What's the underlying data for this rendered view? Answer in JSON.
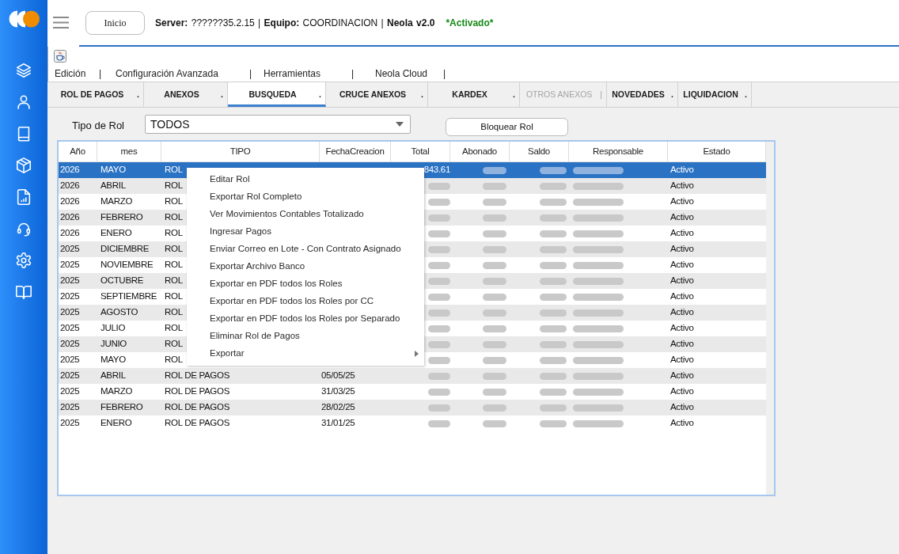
{
  "header": {
    "home_button": "Inicio",
    "status": "**Server:** ??????35.2.15 | **Equipo:** COORDINACION | **Neola v2.0**",
    "activation": "*Activado*"
  },
  "menu_bar": [
    {
      "label": "Edición",
      "separator": "|"
    },
    {
      "label": "Configuración Avanzada",
      "separator": "|"
    },
    {
      "label": "Herramientas",
      "separator": "|"
    },
    {
      "label": "Neola Cloud",
      "separator": "|"
    }
  ],
  "tabs": [
    {
      "label": "ROL DE PAGOS",
      "mark": ".",
      "selected": false,
      "disabled": false
    },
    {
      "label": "ANEXOS",
      "mark": ".",
      "selected": false,
      "disabled": false
    },
    {
      "label": "BUSQUEDA",
      "mark": ".",
      "selected": true,
      "disabled": false
    },
    {
      "label": "CRUCE ANEXOS",
      "mark": ".",
      "selected": false,
      "disabled": false
    },
    {
      "label": "KARDEX",
      "mark": ".",
      "selected": false,
      "disabled": false
    },
    {
      "label": "OTROS ANEXOS",
      "mark": "|",
      "selected": false,
      "disabled": true
    },
    {
      "label": "NOVEDADES",
      "mark": ".",
      "selected": false,
      "disabled": false
    },
    {
      "label": "LIQUIDACION",
      "mark": ".",
      "selected": false,
      "disabled": false
    }
  ],
  "filter": {
    "label": "Tipo de Rol",
    "value": "TODOS"
  },
  "lock_button": "Bloquear Rol",
  "table": {
    "columns": [
      "Año",
      "mes",
      "TIPO",
      "FechaCreacion",
      "Total",
      "Abonado",
      "Saldo",
      "Responsable",
      "Estado"
    ],
    "rows": [
      {
        "year": "2026",
        "month": "MAYO",
        "type": "ROL",
        "total": "843.61",
        "status": "Activo",
        "selected": true,
        "total_blurred": false,
        "paid_blurred": true,
        "balance_blurred": true,
        "responsible_blurred": true
      },
      {
        "year": "2026",
        "month": "ABRIL",
        "type": "ROL",
        "status": "Activo",
        "selected": false,
        "total_blurred": true,
        "paid_blurred": true,
        "balance_blurred": true,
        "responsible_blurred": true
      },
      {
        "year": "2026",
        "month": "MARZO",
        "type": "ROL",
        "status": "Activo",
        "selected": false,
        "total_blurred": true,
        "paid_blurred": true,
        "balance_blurred": true,
        "responsible_blurred": true
      },
      {
        "year": "2026",
        "month": "FEBRERO",
        "type": "ROL",
        "status": "Activo",
        "selected": false,
        "total_blurred": true,
        "paid_blurred": true,
        "balance_blurred": true,
        "responsible_blurred": true
      },
      {
        "year": "2026",
        "month": "ENERO",
        "type": "ROL",
        "status": "Activo",
        "selected": false,
        "total_blurred": true,
        "paid_blurred": true,
        "balance_blurred": true,
        "responsible_blurred": true
      },
      {
        "year": "2025",
        "month": "DICIEMBRE",
        "type": "ROL",
        "status": "Activo",
        "selected": false,
        "total_blurred": true,
        "paid_blurred": true,
        "balance_blurred": true,
        "responsible_blurred": true
      },
      {
        "year": "2025",
        "month": "NOVIEMBRE",
        "type": "ROL",
        "status": "Activo",
        "selected": false,
        "total_blurred": true,
        "paid_blurred": true,
        "balance_blurred": true,
        "responsible_blurred": true
      },
      {
        "year": "2025",
        "month": "OCTUBRE",
        "type": "ROL",
        "status": "Activo",
        "selected": false,
        "total_blurred": true,
        "paid_blurred": true,
        "balance_blurred": true,
        "responsible_blurred": true
      },
      {
        "year": "2025",
        "month": "SEPTIEMBRE",
        "type": "ROL",
        "status": "Activo",
        "selected": false,
        "total_blurred": true,
        "paid_blurred": true,
        "balance_blurred": true,
        "responsible_blurred": true
      },
      {
        "year": "2025",
        "month": "AGOSTO",
        "type": "ROL",
        "status": "Activo",
        "selected": false,
        "total_blurred": true,
        "paid_blurred": true,
        "balance_blurred": true,
        "responsible_blurred": true
      },
      {
        "year": "2025",
        "month": "JULIO",
        "type": "ROL",
        "status": "Activo",
        "selected": false,
        "total_blurred": true,
        "paid_blurred": true,
        "balance_blurred": true,
        "responsible_blurred": true
      },
      {
        "year": "2025",
        "month": "JUNIO",
        "type": "ROL",
        "status": "Activo",
        "selected": false,
        "total_blurred": true,
        "paid_blurred": true,
        "balance_blurred": true,
        "responsible_blurred": true
      },
      {
        "year": "2025",
        "month": "MAYO",
        "type": "ROL",
        "status": "Activo",
        "selected": false,
        "total_blurred": true,
        "paid_blurred": true,
        "balance_blurred": true,
        "responsible_blurred": true
      },
      {
        "year": "2025",
        "month": "ABRIL",
        "type": "ROL DE PAGOS",
        "created": "05/05/25",
        "status": "Activo",
        "selected": false,
        "total_blurred": true,
        "paid_blurred": true,
        "balance_blurred": true,
        "responsible_blurred": true
      },
      {
        "year": "2025",
        "month": "MARZO",
        "type": "ROL DE PAGOS",
        "created": "31/03/25",
        "status": "Activo",
        "selected": false,
        "total_blurred": true,
        "paid_blurred": true,
        "balance_blurred": true,
        "responsible_blurred": true
      },
      {
        "year": "2025",
        "month": "FEBRERO",
        "type": "ROL DE PAGOS",
        "created": "28/02/25",
        "status": "Activo",
        "selected": false,
        "total_blurred": true,
        "paid_blurred": true,
        "balance_blurred": true,
        "responsible_blurred": true
      },
      {
        "year": "2025",
        "month": "ENERO",
        "type": "ROL DE PAGOS",
        "created": "31/01/25",
        "status": "Activo",
        "selected": false,
        "total_blurred": true,
        "paid_blurred": true,
        "balance_blurred": true,
        "responsible_blurred": true
      }
    ]
  },
  "context_menu": {
    "items": [
      {
        "label": "Editar Rol",
        "submenu": false
      },
      {
        "label": "Exportar Rol Completo",
        "submenu": false
      },
      {
        "label": "Ver Movimientos Contables Totalizado",
        "submenu": false
      },
      {
        "label": "Ingresar Pagos",
        "submenu": false
      },
      {
        "label": "Enviar Correo en Lote - Con Contrato Asignado",
        "submenu": false
      },
      {
        "label": "Exportar Archivo Banco",
        "submenu": false
      },
      {
        "label": "Exportar en PDF todos los Roles",
        "submenu": false
      },
      {
        "label": "Exportar en PDF todos los Roles por CC",
        "submenu": false
      },
      {
        "label": "Exportar en PDF todos los Roles por Separado",
        "submenu": false
      },
      {
        "label": "Eliminar Rol de Pagos",
        "submenu": false
      },
      {
        "label": "Exportar",
        "submenu": true
      }
    ]
  }
}
